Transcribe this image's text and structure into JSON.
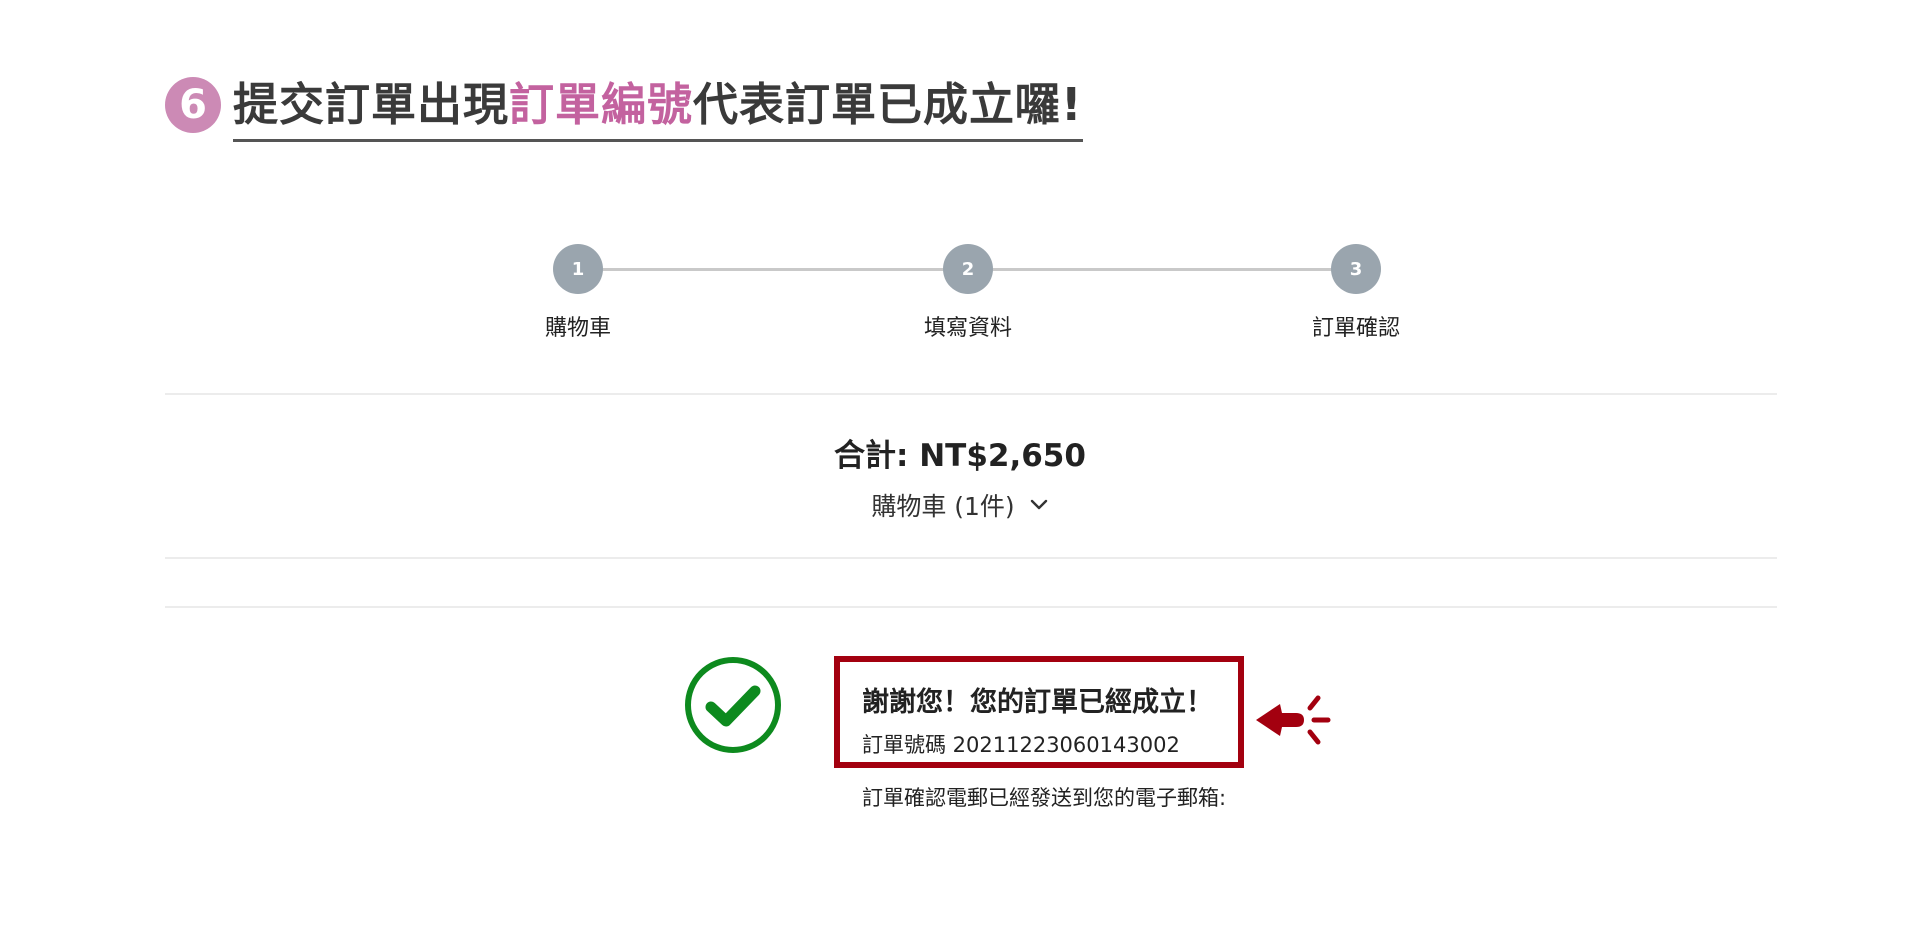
{
  "heading": {
    "step_number": "6",
    "text_before": "提交訂單出現",
    "text_accent": "訂單編號",
    "text_after": "代表訂單已成立囉!"
  },
  "stepper": {
    "steps": [
      {
        "number": "1",
        "label": "購物車"
      },
      {
        "number": "2",
        "label": "填寫資料"
      },
      {
        "number": "3",
        "label": "訂單確認"
      }
    ]
  },
  "summary": {
    "total": "合計: NT$2,650",
    "cart_toggle": "購物車 (1件)",
    "cart_toggle_icon": "chevron-down-icon"
  },
  "confirmation": {
    "icon": "check-circle-icon",
    "thanks": "謝謝您！您的訂單已經成立！",
    "order_number": "訂單號碼 20211223060143002",
    "email_note": "訂單確認電郵已經發送到您的電子郵箱:",
    "pointer_icon": "pointing-hand-icon"
  },
  "colors": {
    "accent_pink": "#c3629f",
    "badge_pink": "#cc8ab5",
    "step_gray": "#9aa5ae",
    "highlight_red": "#a3000f",
    "success_green": "#0d8a1e"
  }
}
